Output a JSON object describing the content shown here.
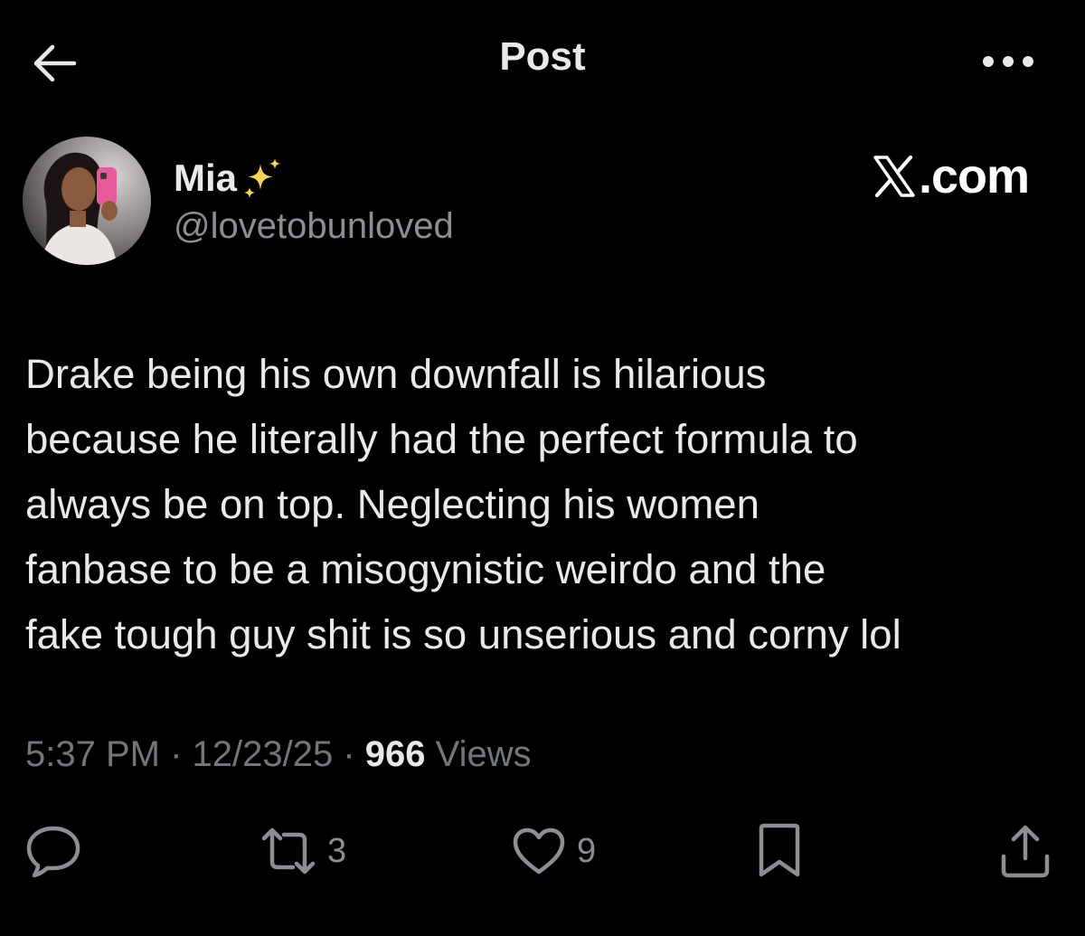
{
  "header": {
    "title": "Post",
    "back_icon": "arrow-left-icon",
    "more_icon": "more-horizontal-icon"
  },
  "author": {
    "display_name": "Mia",
    "name_emoji": "sparkles-icon",
    "handle": "@lovetobunloved"
  },
  "watermark": {
    "text": ".com"
  },
  "post": {
    "text": "Drake being his own downfall is hilarious\nbecause he literally had the perfect formula to\nalways be on top. Neglecting his women\nfanbase to be a misogynistic weirdo and the\nfake tough guy shit is so unserious and corny lol"
  },
  "meta": {
    "time": "5:37 PM",
    "separator": " · ",
    "date": "12/23/25",
    "views_count": "966",
    "views_label": "Views"
  },
  "actions": {
    "reply_icon": "reply-icon",
    "repost_icon": "repost-icon",
    "repost_count": "3",
    "like_icon": "heart-icon",
    "like_count": "9",
    "bookmark_icon": "bookmark-icon",
    "share_icon": "share-icon"
  },
  "colors": {
    "background": "#000000",
    "primary_text": "#e7e9ea",
    "secondary_text": "#71767b",
    "icon": "#8b8f94",
    "sparkle": "#f5d45a"
  }
}
